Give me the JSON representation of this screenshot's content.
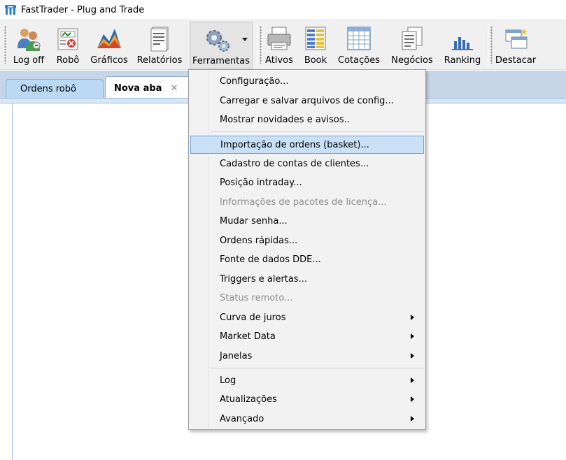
{
  "window": {
    "title": "FastTrader - Plug and Trade"
  },
  "toolbar": {
    "buttons": [
      {
        "label": "Log off",
        "icon": "users-icon"
      },
      {
        "label": "Robô",
        "icon": "robot-icon"
      },
      {
        "label": "Gráficos",
        "icon": "chart-icon"
      },
      {
        "label": "Relatórios",
        "icon": "report-icon"
      },
      {
        "label": "Ferramentas",
        "icon": "gears-icon"
      },
      {
        "label": "Ativos",
        "icon": "printer-icon"
      },
      {
        "label": "Book",
        "icon": "book-icon"
      },
      {
        "label": "Cotações",
        "icon": "grid-icon"
      },
      {
        "label": "Negócios",
        "icon": "documents-icon"
      },
      {
        "label": "Ranking",
        "icon": "bar-chart-icon"
      },
      {
        "label": "Destacar",
        "icon": "windows-icon"
      }
    ]
  },
  "tabs": [
    {
      "label": "Ordens robô"
    },
    {
      "label": "Nova aba",
      "close": "✕"
    }
  ],
  "menu": {
    "items": [
      {
        "label": "Configuração..."
      },
      {
        "label": "Carregar e salvar arquivos de config..."
      },
      {
        "label": "Mostrar novidades e avisos.."
      },
      {
        "label": "Importação de ordens (basket)..."
      },
      {
        "label": "Cadastro de contas de clientes..."
      },
      {
        "label": "Posição intraday..."
      },
      {
        "label": "Informações de pacotes de licença..."
      },
      {
        "label": "Mudar senha..."
      },
      {
        "label": "Ordens rápidas..."
      },
      {
        "label": "Fonte de dados DDE..."
      },
      {
        "label": "Triggers e alertas..."
      },
      {
        "label": "Status remoto..."
      },
      {
        "label": "Curva de juros"
      },
      {
        "label": "Market Data"
      },
      {
        "label": "Janelas"
      },
      {
        "label": "Log"
      },
      {
        "label": "Atualizações"
      },
      {
        "label": "Avançado"
      }
    ]
  }
}
